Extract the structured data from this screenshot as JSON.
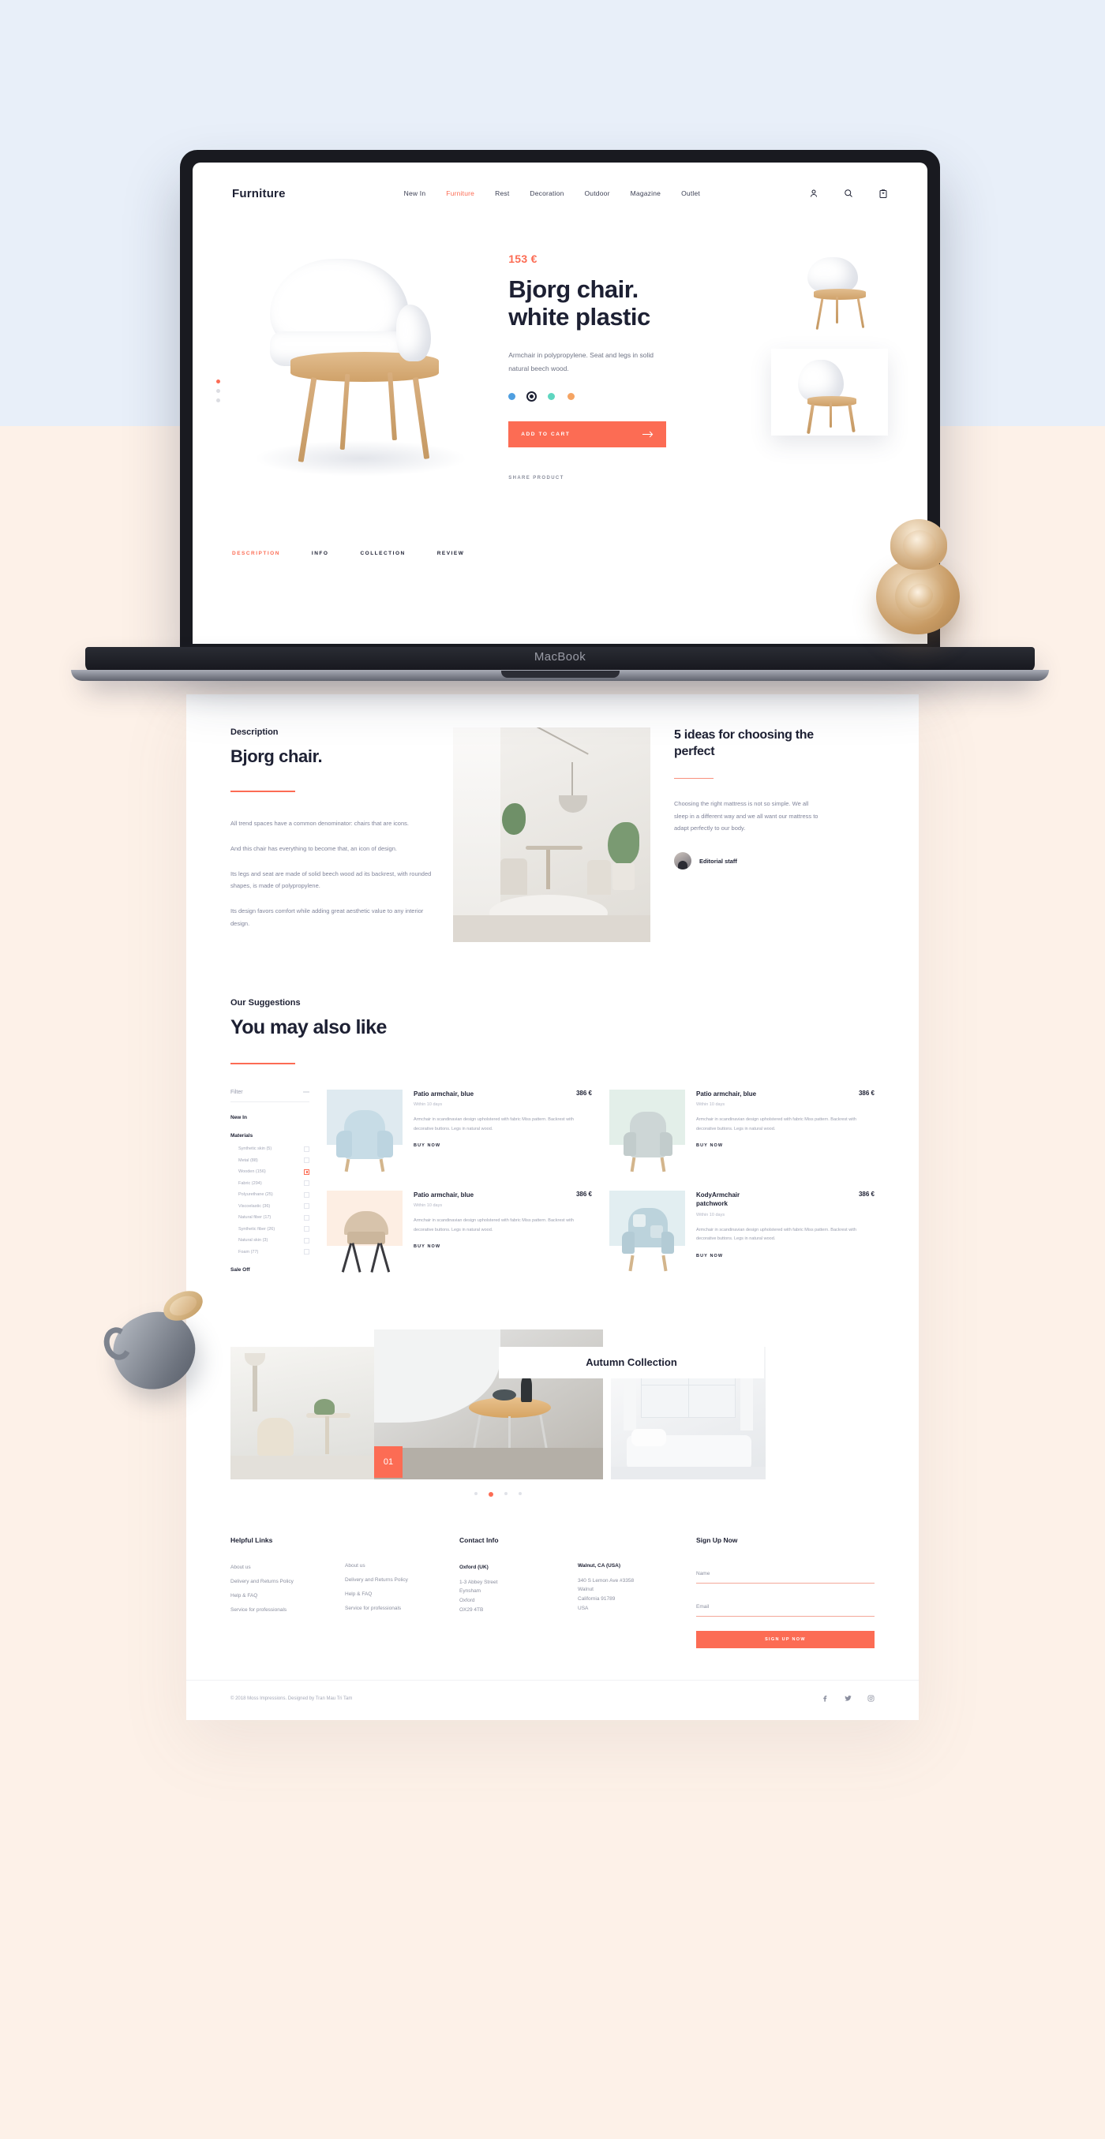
{
  "colors": {
    "accent": "#fc6c54",
    "ink": "#1d2033",
    "muted": "#8b8f9f",
    "bg_top": "#e8eff9",
    "bg_bottom": "#fdf1e8"
  },
  "device": {
    "label": "MacBook"
  },
  "nav": {
    "logo": "Furniture",
    "links": [
      {
        "label": "New In",
        "active": false
      },
      {
        "label": "Furniture",
        "active": true
      },
      {
        "label": "Rest",
        "active": false
      },
      {
        "label": "Decoration",
        "active": false
      },
      {
        "label": "Outdoor",
        "active": false
      },
      {
        "label": "Magazine",
        "active": false
      },
      {
        "label": "Outlet",
        "active": false
      }
    ],
    "icons": [
      "user-icon",
      "search-icon",
      "bag-icon"
    ]
  },
  "hero": {
    "price": "153 €",
    "title_line1": "Bjorg chair.",
    "title_line2": "white plastic",
    "description": "Armchair in polypropylene. Seat and legs in solid natural beech wood.",
    "swatches": [
      "#4f9fe0",
      "#1d2033",
      "#5fd6c0",
      "#f5a463"
    ],
    "selected_swatch_index": 1,
    "cta": "ADD TO CART",
    "share": "SHARE PRODUCT"
  },
  "tabs": [
    {
      "label": "DESCRIPTION",
      "active": true
    },
    {
      "label": "INFO",
      "active": false
    },
    {
      "label": "COLLECTION",
      "active": false
    },
    {
      "label": "REVIEW",
      "active": false
    }
  ],
  "description": {
    "kicker": "Description",
    "title": "Bjorg chair.",
    "paragraphs": [
      "All trend spaces have a common denominator: chairs that are icons.",
      "And this chair has everything to become that, an icon of design.",
      "Its legs and seat are made of solid beech wood ad its backrest, with rounded shapes, is made of polypropylene.",
      "Its design favors comfort while adding great aesthetic value to any interior design."
    ]
  },
  "article": {
    "title": "5 ideas for choosing the perfect",
    "excerpt": "Choosing the right mattress is not so simple. We all sleep in a different way and we all want our mattress to adapt perfectly to our body.",
    "author": "Editorial staff"
  },
  "suggestions": {
    "kicker": "Our Suggestions",
    "title": "You may also like",
    "filter": {
      "title": "Filter",
      "collapse_icon": "minus-icon",
      "groups": [
        {
          "label": "New In"
        },
        {
          "label": "Materials"
        }
      ],
      "materials": [
        {
          "label": "Synthetic skin (5)",
          "checked": false
        },
        {
          "label": "Metal (88)",
          "checked": false
        },
        {
          "label": "Wooden (156)",
          "checked": true
        },
        {
          "label": "Fabric (294)",
          "checked": false
        },
        {
          "label": "Polyurethane (25)",
          "checked": false
        },
        {
          "label": "Viscoelastic (36)",
          "checked": false
        },
        {
          "label": "Natural fiber (17)",
          "checked": false
        },
        {
          "label": "Synthetic fiber (26)",
          "checked": false
        },
        {
          "label": "Natural skin (3)",
          "checked": false
        },
        {
          "label": "Foam (77)",
          "checked": false
        }
      ],
      "sale_group": "Sale Off"
    },
    "products": [
      {
        "name": "Patio armchair, blue",
        "price": "386 €",
        "eta": "Within 10 days",
        "desc": "Armchair in scandinavian design upholstered with fabric Miss pattern. Backrest with decorative buttons. Legs in natural wood.",
        "buy": "BUY NOW",
        "swatch": "#dfeaf0",
        "chair_color": "#c7dce6"
      },
      {
        "name": "Patio armchair, blue",
        "price": "386 €",
        "eta": "Within 10 days",
        "desc": "Armchair in scandinavian design upholstered with fabric Miss pattern. Backrest with decorative buttons. Legs in natural wood.",
        "buy": "BUY NOW",
        "swatch": "#e3efe9",
        "chair_color": "#cdd6d6"
      },
      {
        "name": "Patio armchair, blue",
        "price": "386 €",
        "eta": "Within 10 days",
        "desc": "Armchair in scandinavian design upholstered with fabric Miss pattern. Backrest with decorative buttons. Legs in natural wood.",
        "buy": "BUY NOW",
        "swatch": "#fdeee3",
        "chair_color": "#d7c3ab"
      },
      {
        "name": "KodyArmchair patchwork",
        "price": "386 €",
        "eta": "Within 10 days",
        "desc": "Armchair in scandinavian design upholstered with fabric Miss pattern. Backrest with decorative buttons. Legs in natural wood.",
        "buy": "BUY NOW",
        "swatch": "#e2eef1",
        "chair_color": "#bcd3dc"
      }
    ]
  },
  "collection": {
    "title": "Autumn Collection",
    "badge": "01",
    "dots_count": 4,
    "active_dot_index": 1
  },
  "footer": {
    "helpful_links_title": "Helpful Links",
    "links_col1": [
      "About us",
      "Delivery and Returns Policy",
      "Help & FAQ",
      "Service for professionals"
    ],
    "links_col2": [
      "About us",
      "Delivery and Returns Policy",
      "Help & FAQ",
      "Service for professionals"
    ],
    "contact_title": "Contact Info",
    "addresses": [
      {
        "city": "Oxford (UK)",
        "lines": [
          "1-3 Abbey Street",
          "Eynsham",
          "Oxford",
          "OX29 4TB"
        ]
      },
      {
        "city": "Walnut, CA (USA)",
        "lines": [
          "340 S Lemon Ave #3358",
          "Walnut",
          "California 91789",
          "USA"
        ]
      }
    ],
    "signup_title": "Sign Up Now",
    "name_label": "Name",
    "email_label": "Email",
    "signup_button": "SIGN UP NOW",
    "copyright": "© 2018 Moss Impressions. Designed by Tran Mau Tri Tam",
    "socials": [
      "facebook-icon",
      "twitter-icon",
      "instagram-icon"
    ]
  }
}
